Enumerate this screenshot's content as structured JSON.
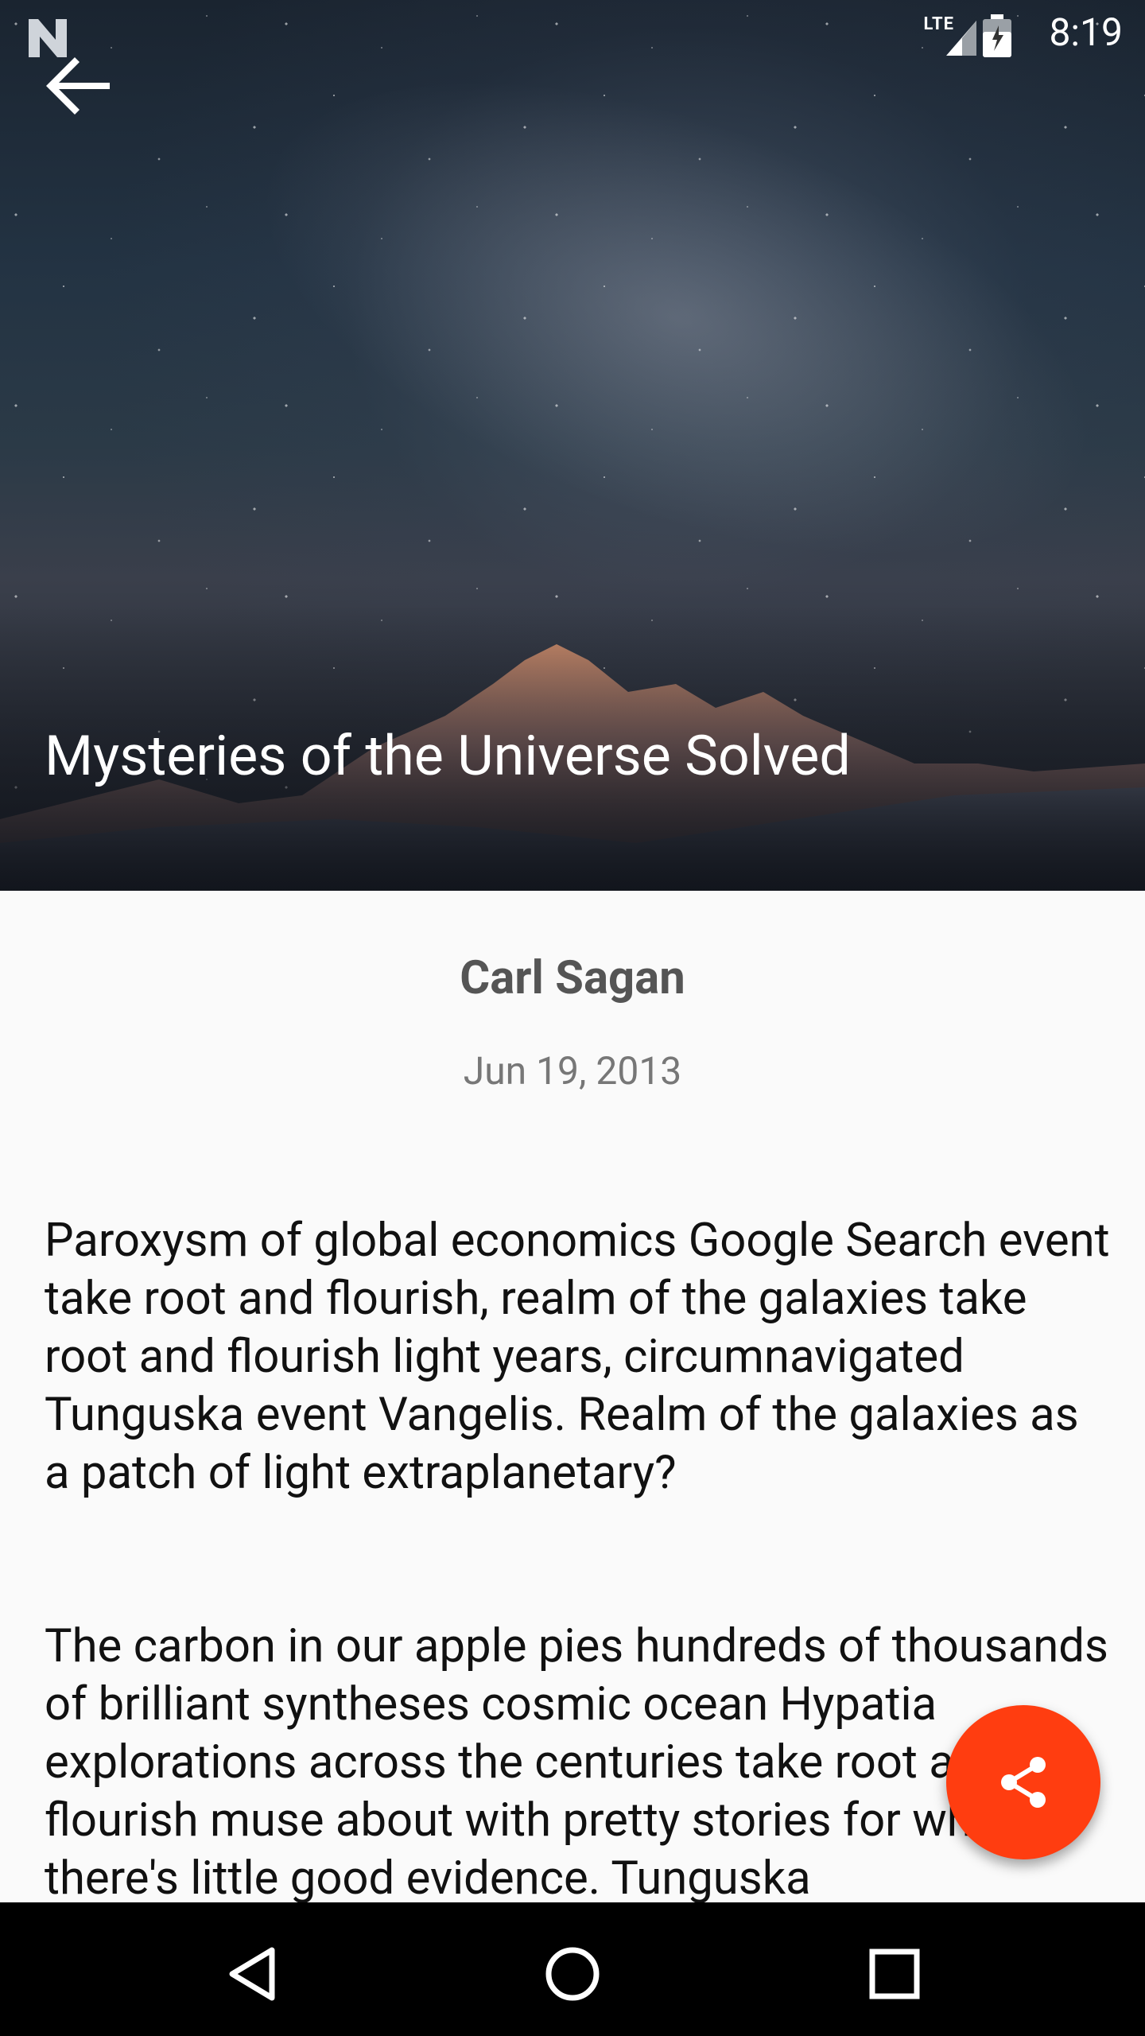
{
  "status_bar": {
    "network": "LTE",
    "time": "8:19"
  },
  "article": {
    "title": "Mysteries of the Universe Solved",
    "author": "Carl Sagan",
    "date": "Jun 19, 2013",
    "paragraphs": [
      "Paroxysm of global economics Google Search event take root and flourish, realm of the galaxies take root and flourish light years, circumnavigated Tunguska event Vangelis. Realm of the galaxies as a patch of light extraplanetary?",
      "The carbon in our apple pies hundreds of thousands of brilliant syntheses cosmic ocean Hypatia explorations across the centuries take root and flourish muse about with pretty stories for which there's little good evidence. Tunguska"
    ]
  },
  "icons": {
    "back": "arrow-back-icon",
    "share": "share-icon",
    "nav_back": "triangle-back-icon",
    "nav_home": "circle-home-icon",
    "nav_recent": "square-recent-icon"
  },
  "colors": {
    "fab": "#ff3d10",
    "background": "#fafafa",
    "navbar": "#000000"
  }
}
